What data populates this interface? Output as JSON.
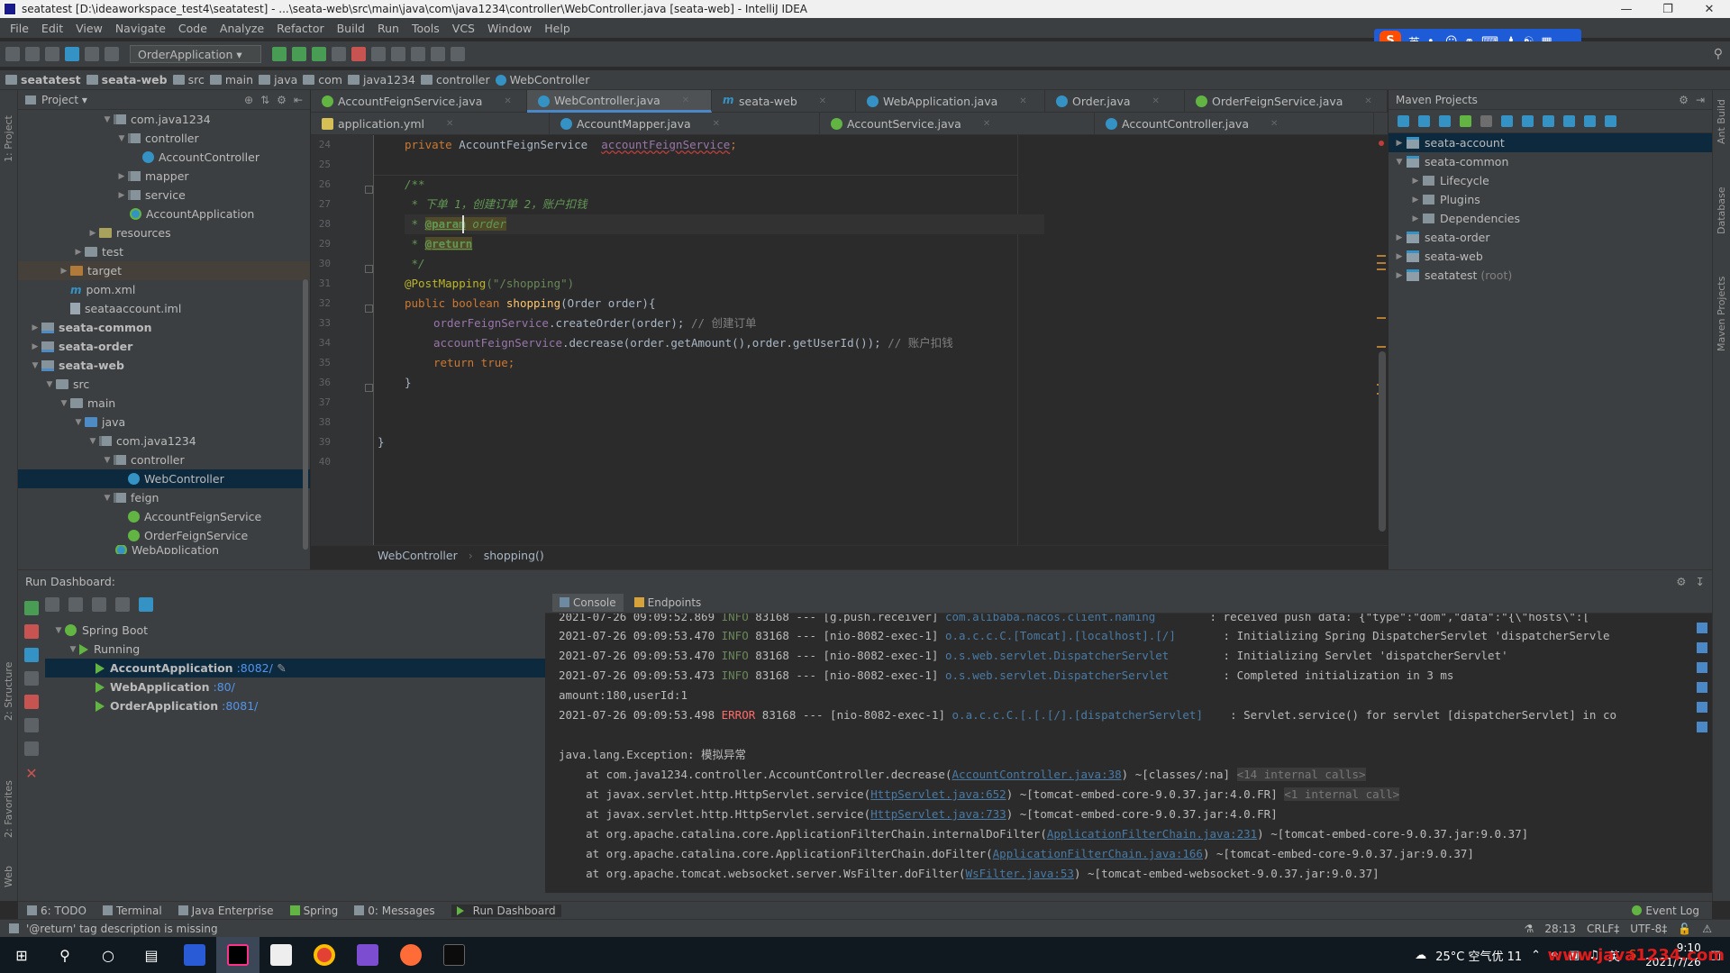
{
  "window": {
    "title": "seatatest [D:\\ideaworkspace_test4\\seatatest] - ...\\seata-web\\src\\main\\java\\com\\java1234\\controller\\WebController.java [seata-web] - IntelliJ IDEA"
  },
  "menu": [
    "File",
    "Edit",
    "View",
    "Navigate",
    "Code",
    "Analyze",
    "Refactor",
    "Build",
    "Run",
    "Tools",
    "VCS",
    "Window",
    "Help"
  ],
  "ime": {
    "logo": "S",
    "lang": "英"
  },
  "toolbar": {
    "run_config": "OrderApplication"
  },
  "breadcrumbs": [
    "seatatest",
    "seata-web",
    "src",
    "main",
    "java",
    "com",
    "java1234",
    "controller",
    "WebController"
  ],
  "project_panel": {
    "title": "Project",
    "nodes": [
      {
        "label": "com.java1234",
        "kind": "pkg"
      },
      {
        "label": "controller",
        "kind": "pkg"
      },
      {
        "label": "AccountController",
        "kind": "class"
      },
      {
        "label": "mapper",
        "kind": "pkg"
      },
      {
        "label": "service",
        "kind": "pkg"
      },
      {
        "label": "AccountApplication",
        "kind": "app"
      },
      {
        "label": "resources",
        "kind": "res"
      },
      {
        "label": "test",
        "kind": "folder"
      },
      {
        "label": "target",
        "kind": "tgt"
      },
      {
        "label": "pom.xml",
        "kind": "m"
      },
      {
        "label": "seataaccount.iml",
        "kind": "file"
      },
      {
        "label": "seata-common",
        "kind": "mod"
      },
      {
        "label": "seata-order",
        "kind": "mod"
      },
      {
        "label": "seata-web",
        "kind": "mod"
      },
      {
        "label": "src",
        "kind": "folder"
      },
      {
        "label": "main",
        "kind": "folder"
      },
      {
        "label": "java",
        "kind": "src"
      },
      {
        "label": "com.java1234",
        "kind": "pkg"
      },
      {
        "label": "controller",
        "kind": "pkg"
      },
      {
        "label": "WebController",
        "kind": "class"
      },
      {
        "label": "feign",
        "kind": "pkg"
      },
      {
        "label": "AccountFeignService",
        "kind": "iface"
      },
      {
        "label": "OrderFeignService",
        "kind": "iface"
      },
      {
        "label": "WebApplication",
        "kind": "app"
      }
    ]
  },
  "tabs_row1": [
    {
      "label": "AccountFeignService.java",
      "icon": "i"
    },
    {
      "label": "WebController.java",
      "icon": "c",
      "active": true
    },
    {
      "label": "seata-web",
      "icon": "m"
    },
    {
      "label": "WebApplication.java",
      "icon": "c"
    },
    {
      "label": "Order.java",
      "icon": "c"
    },
    {
      "label": "OrderFeignService.java",
      "icon": "i"
    }
  ],
  "tabs_row2": [
    {
      "label": "application.yml",
      "icon": "y"
    },
    {
      "label": "AccountMapper.java",
      "icon": "c"
    },
    {
      "label": "AccountService.java",
      "icon": "i"
    },
    {
      "label": "AccountController.java",
      "icon": "c"
    }
  ],
  "editor": {
    "line_numbers": [
      "24",
      "25",
      "26",
      "27",
      "28",
      "29",
      "30",
      "31",
      "32",
      "33",
      "34",
      "35",
      "36",
      "37",
      "38",
      "39",
      "40"
    ],
    "lines": {
      "l24_kw": "private ",
      "l24_type": "AccountFeignService  ",
      "l24_field": "accountFeignService",
      "l24_end": ";",
      "l26": "/**",
      "l27": " * 下单 1，创建订单 2，账户扣钱",
      "l28_star": " * ",
      "l28_tag": "@param",
      "l28_param": " order",
      "l29_star": " * ",
      "l29_tag": "@return",
      "l30": " */",
      "l31_ann": "@PostMapping",
      "l31_args": "(\"/shopping\")",
      "l32_kw": "public boolean ",
      "l32_fn": "shopping",
      "l32_rest": "(Order order){",
      "l33_field": "orderFeignService",
      "l33_rest": ".createOrder(order); ",
      "l33_cm": "// 创建订单",
      "l34_field": "accountFeignService",
      "l34_rest": ".decrease(order.getAmount(),order.getUserId()); ",
      "l34_cm": "// 账户扣钱",
      "l35_kw": "return true",
      "l35_end": ";",
      "l36": "}",
      "l39": "}"
    },
    "breadcrumb": [
      "WebController",
      "shopping()"
    ]
  },
  "maven": {
    "title": "Maven Projects",
    "nodes": [
      {
        "label": "seata-account",
        "depth": 0,
        "sel": true
      },
      {
        "label": "seata-common",
        "depth": 0,
        "open": true
      },
      {
        "label": "Lifecycle",
        "depth": 1
      },
      {
        "label": "Plugins",
        "depth": 1
      },
      {
        "label": "Dependencies",
        "depth": 1
      },
      {
        "label": "seata-order",
        "depth": 0
      },
      {
        "label": "seata-web",
        "depth": 0
      },
      {
        "label": "seatatest",
        "suffix": "(root)",
        "depth": 0
      }
    ]
  },
  "run_dashboard": {
    "title": "Run Dashboard:",
    "root": "Spring Boot",
    "group": "Running",
    "apps": [
      {
        "name": "AccountApplication",
        "port": ":8082/"
      },
      {
        "name": "WebApplication",
        "port": ":80/"
      },
      {
        "name": "OrderApplication",
        "port": ":8081/"
      }
    ],
    "tabs": [
      "Console",
      "Endpoints"
    ],
    "console": [
      {
        "ts": "2021-07-26 09:09:52.869",
        "lvl": "INFO",
        "rest": " 83168 --- [g.push.receiver] ",
        "cls": "com.alibaba.nacos.client.naming",
        "msg": "        : received push data: {\"type\":\"dom\",\"data\":\"{\\\"hosts\\\":["
      },
      {
        "ts": "2021-07-26 09:09:53.470",
        "lvl": "INFO",
        "rest": " 83168 --- [nio-8082-exec-1] ",
        "cls": "o.a.c.c.C.[Tomcat].[localhost].[/]",
        "msg": "       : Initializing Spring DispatcherServlet 'dispatcherServle"
      },
      {
        "ts": "2021-07-26 09:09:53.470",
        "lvl": "INFO",
        "rest": " 83168 --- [nio-8082-exec-1] ",
        "cls": "o.s.web.servlet.DispatcherServlet",
        "msg": "        : Initializing Servlet 'dispatcherServlet'"
      },
      {
        "ts": "2021-07-26 09:09:53.473",
        "lvl": "INFO",
        "rest": " 83168 --- [nio-8082-exec-1] ",
        "cls": "o.s.web.servlet.DispatcherServlet",
        "msg": "        : Completed initialization in 3 ms"
      },
      {
        "plain": "amount:180,userId:1"
      },
      {
        "ts": "2021-07-26 09:09:53.498",
        "lvl": "ERROR",
        "rest": " 83168 --- [nio-8082-exec-1] ",
        "cls": "o.a.c.c.C.[.[.[/].[dispatcherServlet]",
        "msg": "    : Servlet.service() for servlet [dispatcherServlet] in co"
      },
      {
        "plain": ""
      },
      {
        "plain": "java.lang.Exception: 模拟异常"
      },
      {
        "pre": "    at com.java1234.controller.AccountController.decrease(",
        "link": "AccountController.java:38",
        "post": ") ~[classes/:na] ",
        "gray": "<14 internal calls>"
      },
      {
        "pre": "    at javax.servlet.http.HttpServlet.service(",
        "link": "HttpServlet.java:652",
        "post": ") ~[tomcat-embed-core-9.0.37.jar:4.0.FR] ",
        "gray": "<1 internal call>"
      },
      {
        "pre": "    at javax.servlet.http.HttpServlet.service(",
        "link": "HttpServlet.java:733",
        "post": ") ~[tomcat-embed-core-9.0.37.jar:4.0.FR]"
      },
      {
        "pre": "    at org.apache.catalina.core.ApplicationFilterChain.internalDoFilter(",
        "link": "ApplicationFilterChain.java:231",
        "post": ") ~[tomcat-embed-core-9.0.37.jar:9.0.37]"
      },
      {
        "pre": "    at org.apache.catalina.core.ApplicationFilterChain.doFilter(",
        "link": "ApplicationFilterChain.java:166",
        "post": ") ~[tomcat-embed-core-9.0.37.jar:9.0.37]"
      },
      {
        "pre": "    at org.apache.tomcat.websocket.server.WsFilter.doFilter(",
        "link": "WsFilter.java:53",
        "post": ") ~[tomcat-embed-websocket-9.0.37.jar:9.0.37]"
      }
    ]
  },
  "bottom_tabs": [
    "6: TODO",
    "Terminal",
    "Java Enterprise",
    "Spring",
    "0: Messages",
    "Run Dashboard"
  ],
  "event_log": "Event Log",
  "status": {
    "message": "'@return' tag description is missing",
    "position": "28:13",
    "line_sep": "CRLF‡",
    "encoding": "UTF-8‡"
  },
  "taskbar": {
    "weather": "25°C 空气优 11",
    "ime": "英",
    "time": "9:10",
    "date": "2021/7/26",
    "watermark": "www.java1234.com"
  },
  "side_labels": {
    "project": "1: Project",
    "structure": "2: Structure",
    "favorites": "2: Favorites",
    "web": "Web",
    "maven_side": "Maven Projects",
    "database": "Database",
    "ant": "Ant Build"
  }
}
